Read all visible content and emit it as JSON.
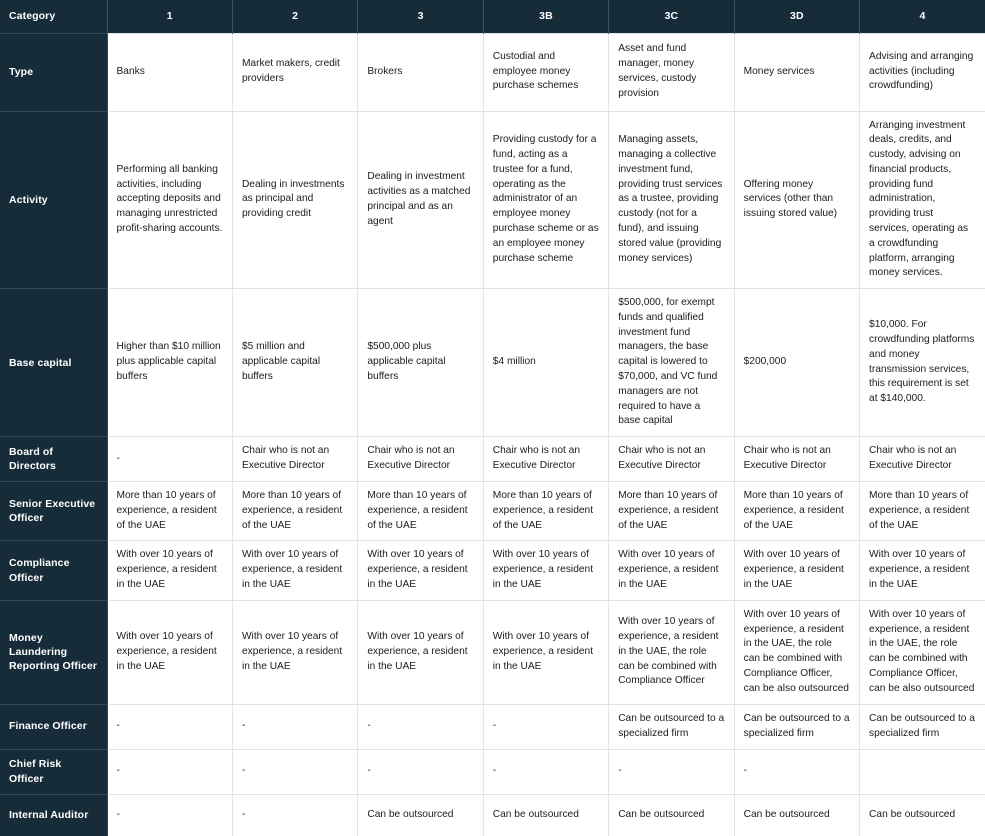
{
  "table": {
    "columns": [
      {
        "key": "category",
        "label": "Category"
      },
      {
        "key": "c1",
        "label": "1"
      },
      {
        "key": "c2",
        "label": "2"
      },
      {
        "key": "c3",
        "label": "3"
      },
      {
        "key": "c3b",
        "label": "3B"
      },
      {
        "key": "c3c",
        "label": "3C"
      },
      {
        "key": "c3d",
        "label": "3D"
      },
      {
        "key": "c4",
        "label": "4"
      }
    ],
    "rows": [
      {
        "label": "Type",
        "cells": [
          "Banks",
          "Market makers, credit providers",
          "Brokers",
          "Custodial and employee money purchase schemes",
          "Asset and fund manager, money services, custody provision",
          "Money services",
          "Advising and arranging activities (including crowdfunding)"
        ]
      },
      {
        "label": "Activity",
        "cells": [
          "Performing all banking activities, including accepting deposits and managing unrestricted profit-sharing accounts.",
          "Dealing in investments as principal and providing credit",
          "Dealing in investment activities as a matched principal and as an agent",
          "Providing custody for a fund, acting as a trustee for a fund, operating as the administrator of an employee money purchase scheme or as an employee money purchase scheme",
          "Managing assets, managing a collective investment fund, providing trust services as a trustee, providing custody (not for a fund), and issuing stored value (providing money services)",
          "Offering money services (other than issuing stored value)",
          "Arranging investment deals, credits, and custody, advising on financial products, providing fund administration, providing trust services, operating as a crowdfunding platform, arranging money services."
        ]
      },
      {
        "label": "Base capital",
        "cells": [
          "Higher than $10 million plus applicable capital buffers",
          "$5 million and applicable capital buffers",
          "$500,000 plus applicable capital buffers",
          "$4 million",
          "$500,000, for exempt funds and qualified investment fund managers, the base capital is lowered to $70,000, and VC fund managers are not required to have a base capital",
          "$200,000",
          "$10,000. For crowdfunding platforms and money transmission services, this requirement is set at $140,000."
        ]
      },
      {
        "label": "Board of Directors",
        "cells": [
          "-",
          "Chair who is not an Executive Director",
          "Chair who is not an Executive Director",
          "Chair who is not an Executive Director",
          "Chair who is not an Executive Director",
          "Chair who is not an Executive Director",
          "Chair who is not an Executive Director"
        ]
      },
      {
        "label": "Senior Executive Officer",
        "cells": [
          "More than 10 years of experience, a resident of the UAE",
          "More than 10 years of experience, a resident of the UAE",
          "More than 10 years of experience, a resident of the UAE",
          "More than 10 years of experience, a resident of the UAE",
          "More than 10 years of experience, a resident of the UAE",
          "More than 10 years of experience, a resident of the UAE",
          "More than 10 years of experience, a resident of the UAE"
        ]
      },
      {
        "label": "Compliance Officer",
        "cells": [
          "With over 10 years of experience, a resident in the UAE",
          "With over 10 years of experience, a resident in the UAE",
          "With over 10 years of experience, a resident in the UAE",
          "With over 10 years of experience, a resident in the UAE",
          "With over 10 years of experience, a resident in the UAE",
          "With over 10 years of experience, a resident in the UAE",
          "With over 10 years of experience, a resident in the UAE"
        ]
      },
      {
        "label": "Money Laundering Reporting Officer",
        "cells": [
          "With over 10 years of experience, a resident in the UAE",
          "With over 10 years of experience, a resident in the UAE",
          "With over 10 years of experience, a resident in the UAE",
          "With over 10 years of experience, a resident in the UAE",
          "With over 10 years of experience, a resident in the UAE, the role can be combined with Compliance Officer",
          "With over 10 years of experience, a resident in the UAE, the role can be combined with Compliance Officer, can be also outsourced",
          "With over 10 years of experience, a resident in the UAE, the role can be combined with Compliance Officer, can be also outsourced"
        ]
      },
      {
        "label": "Finance Officer",
        "cells": [
          "-",
          "-",
          "-",
          "-",
          "Can be outsourced to a specialized firm",
          "Can be outsourced to a specialized firm",
          "Can be outsourced to a specialized firm"
        ]
      },
      {
        "label": "Chief Risk Officer",
        "cells": [
          "-",
          "-",
          "-",
          "-",
          "-",
          "-",
          ""
        ]
      },
      {
        "label": "Internal Auditor",
        "cells": [
          "-",
          "-",
          "Can be outsourced",
          "Can be outsourced",
          "Can be outsourced",
          "Can be outsourced",
          "Can be outsourced"
        ]
      }
    ]
  },
  "colors": {
    "header_bg": "#162c38",
    "header_text": "#ffffff",
    "cell_bg": "#ffffff",
    "cell_text": "#1c1c20",
    "grid_line": "#e2e4e7",
    "header_divider": "#3e5562"
  }
}
